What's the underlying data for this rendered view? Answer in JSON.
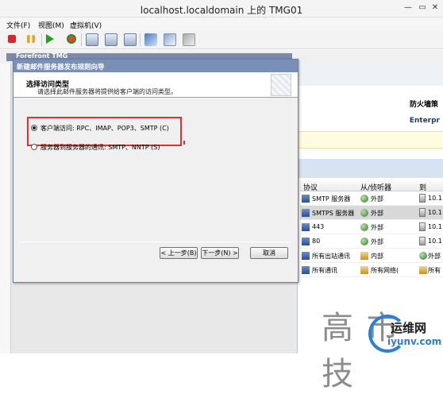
{
  "vm": {
    "title": "localhost.localdomain 上的 TMG01",
    "menu": [
      "文件(F)",
      "视图(M)",
      "虚拟机(V)"
    ]
  },
  "guest": {
    "app_title": "Forefront TMG",
    "firewall_label": "防火墙策",
    "edition_label": "Enterpr"
  },
  "rules_table": {
    "headers": [
      "协议",
      "从/侦听器",
      "到"
    ],
    "rows": [
      {
        "protocol": "SMTP 服务器",
        "from": "外部",
        "to": "10.1",
        "selected": false
      },
      {
        "protocol": "SMTPS 服务器",
        "from": "外部",
        "to": "10.1",
        "selected": true
      },
      {
        "protocol": "443",
        "from": "外部",
        "to": "10.1",
        "selected": false
      },
      {
        "protocol": "80",
        "from": "外部",
        "to": "10.1",
        "selected": false
      },
      {
        "protocol": "所有出站通讯",
        "from": "内部",
        "to": "外部",
        "selected": false
      },
      {
        "protocol": "所有通讯",
        "from": "所有网络(",
        "to": "所有",
        "selected": false
      }
    ]
  },
  "wizard": {
    "title": "新建邮件服务器发布规则向导",
    "heading": "选择访问类型",
    "subheading": "请选择此邮件服务器将提供给客户端的访问类型。",
    "options": [
      {
        "label": "客户端访问: RPC、IMAP、POP3、SMTP (C)",
        "checked": true
      },
      {
        "label": "服务器到服务器的通讯: SMTP、NNTP (S)",
        "checked": false
      }
    ],
    "buttons": {
      "back": "< 上一步(B)",
      "next": "下一步(N) >",
      "cancel": "取消"
    }
  },
  "watermark": {
    "big_text": "高 市 技",
    "site_name": "运维网",
    "site_url": "iyunv.com"
  },
  "colors": {
    "highlight_box": "#e0302e",
    "dialog_title": "#7a8fb8",
    "network_icon": "#2f7a3a"
  }
}
